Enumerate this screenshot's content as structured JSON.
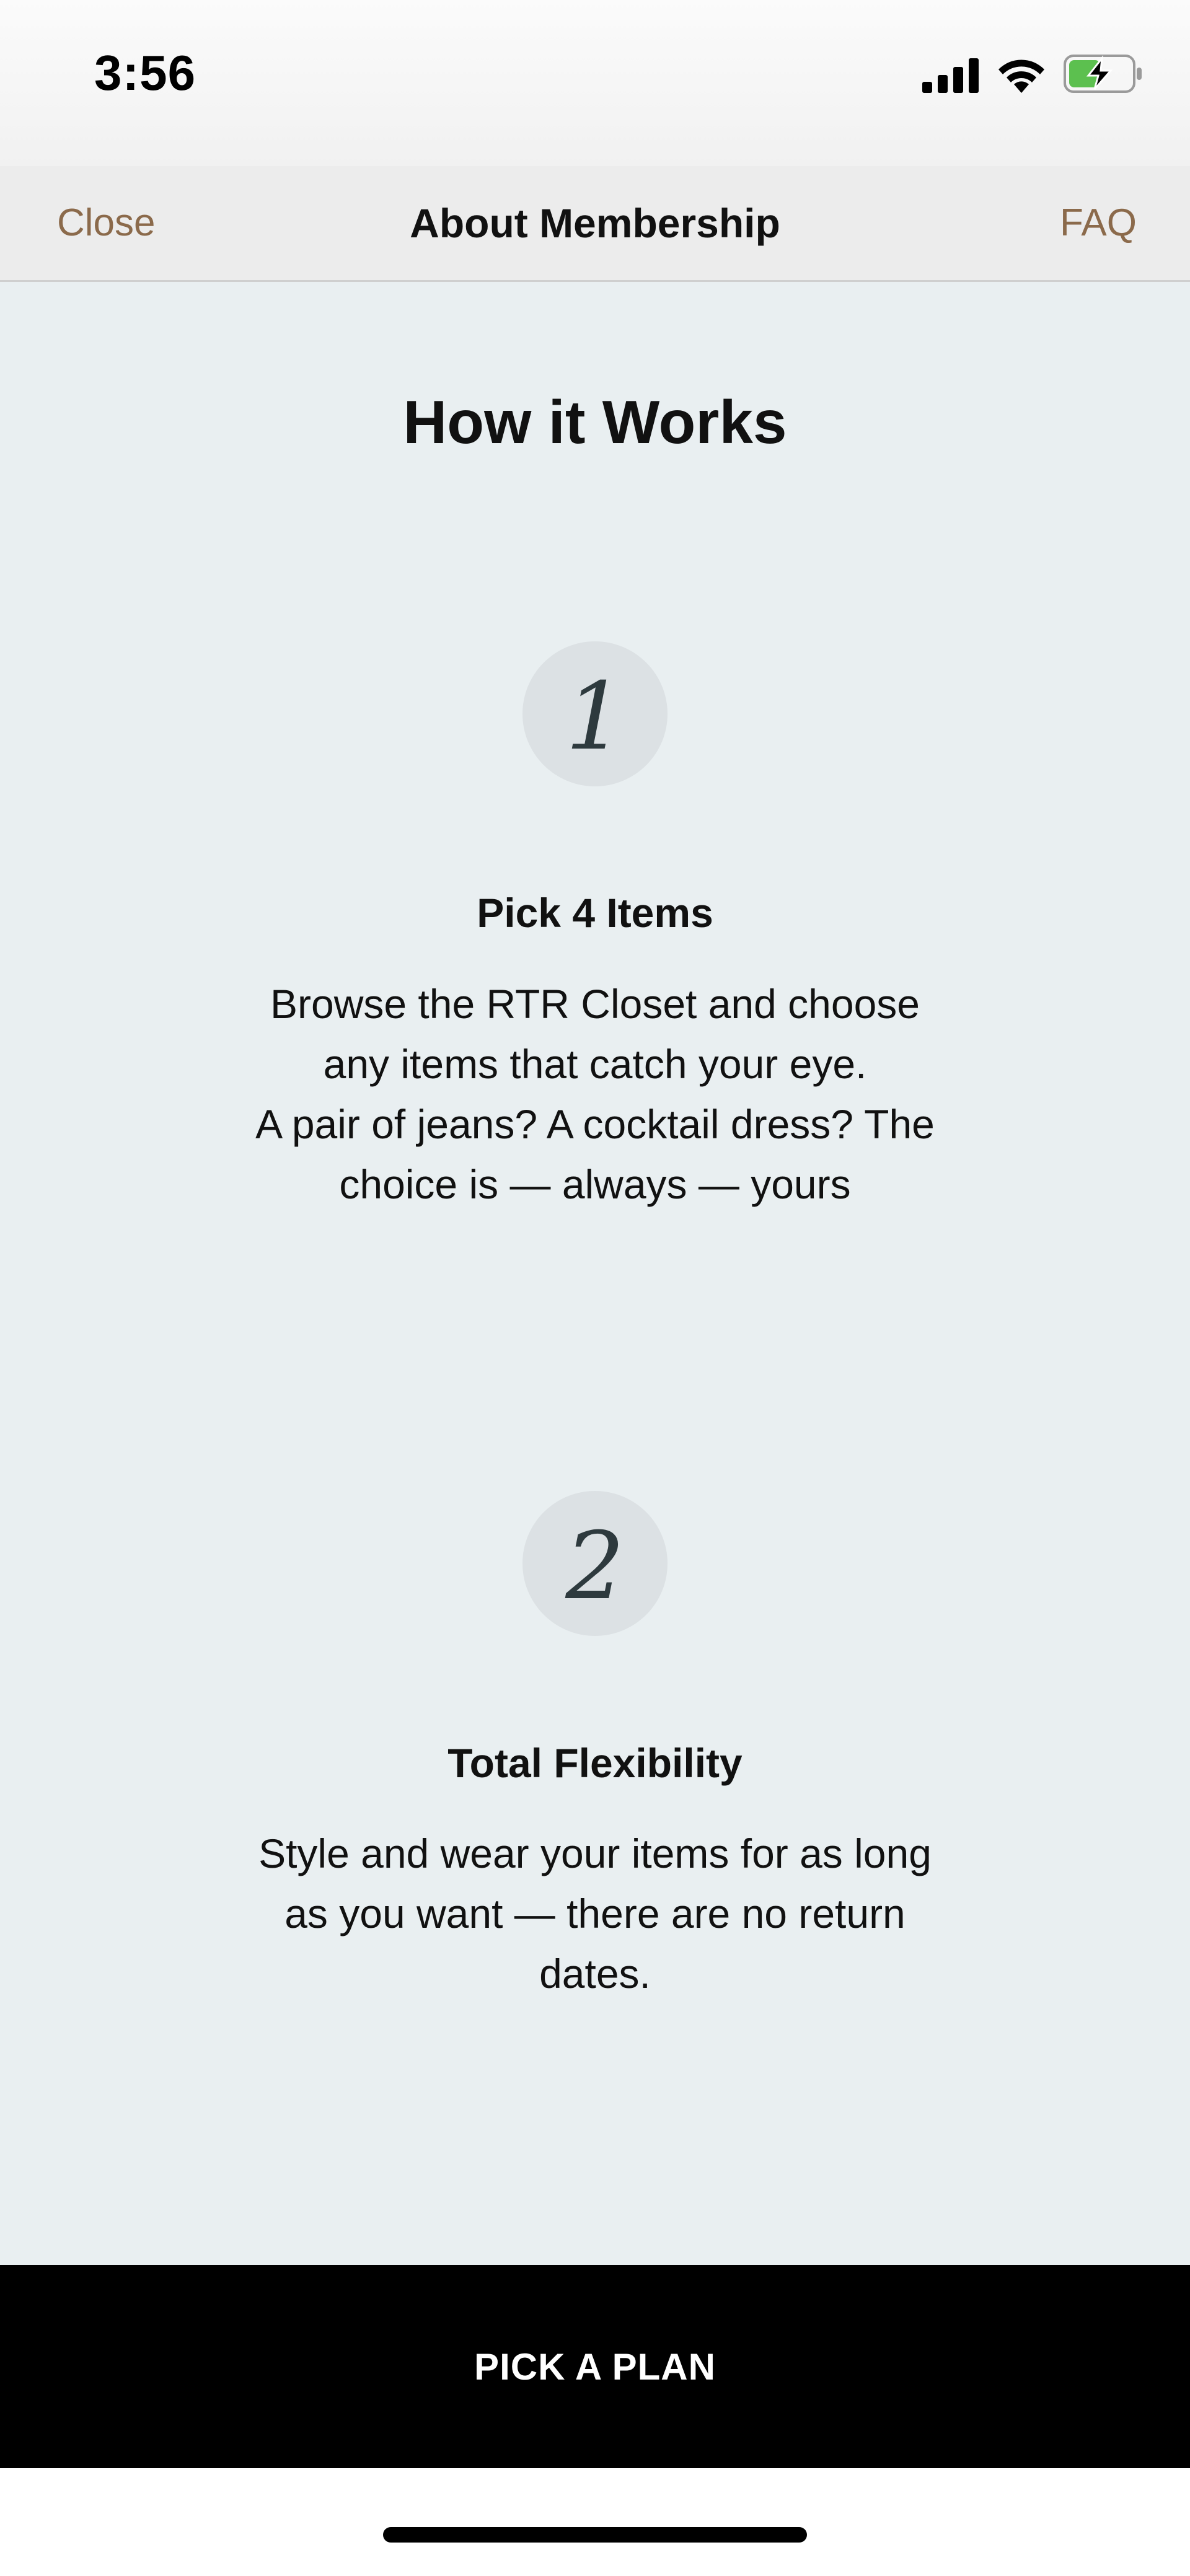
{
  "status_bar": {
    "time": "3:56",
    "icons": [
      "signal-icon",
      "wifi-icon",
      "battery-charging-icon"
    ],
    "battery_color": "#5cc04f"
  },
  "nav": {
    "close_label": "Close",
    "title": "About Membership",
    "faq_label": "FAQ",
    "accent_color": "#8b6a4b"
  },
  "main": {
    "title": "How it Works",
    "steps": [
      {
        "number": "1",
        "title": "Pick 4 Items",
        "description_lines": [
          "Browse the RTR Closet and choose",
          "any items that catch your eye.",
          "A pair of jeans? A cocktail dress? The",
          "choice is — always — yours"
        ]
      },
      {
        "number": "2",
        "title": "Total Flexibility",
        "description_lines": [
          "Style and wear your items for as long",
          "as you want — there are no return",
          "dates."
        ]
      }
    ]
  },
  "cta": {
    "label": "PICK A PLAN"
  }
}
